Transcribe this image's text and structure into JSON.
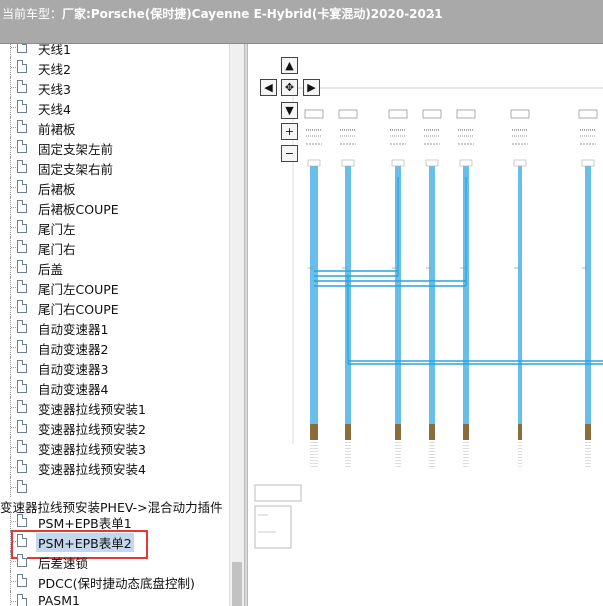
{
  "header": {
    "label": "当前车型：",
    "value": "厂家:Porsche(保时捷)Cayenne E-Hybrid(卡宴混动)2020-2021"
  },
  "tree": {
    "items": [
      {
        "label": "天线1"
      },
      {
        "label": "天线2"
      },
      {
        "label": "天线3"
      },
      {
        "label": "天线4"
      },
      {
        "label": "前裙板"
      },
      {
        "label": "固定支架左前"
      },
      {
        "label": "固定支架右前"
      },
      {
        "label": "后裙板"
      },
      {
        "label": "后裙板COUPE"
      },
      {
        "label": "尾门左"
      },
      {
        "label": "尾门右"
      },
      {
        "label": "后盖"
      },
      {
        "label": "尾门左COUPE"
      },
      {
        "label": "尾门右COUPE"
      },
      {
        "label": "自动变速器1"
      },
      {
        "label": "自动变速器2"
      },
      {
        "label": "自动变速器3"
      },
      {
        "label": "自动变速器4"
      },
      {
        "label": "变速器拉线预安装1"
      },
      {
        "label": "变速器拉线预安装2"
      },
      {
        "label": "变速器拉线预安装3"
      },
      {
        "label": "变速器拉线预安装4"
      },
      {
        "label": ""
      }
    ],
    "folder": "变速器拉线预安装PHEV->混合动力插件",
    "sub_items": [
      {
        "label": "PSM+EPB表单1"
      },
      {
        "label": "PSM+EPB表单2",
        "selected": true
      },
      {
        "label": "后差速锁"
      },
      {
        "label": "PDCC(保时捷动态底盘控制)"
      },
      {
        "label": "PASM1"
      }
    ]
  },
  "nav": {
    "up": "▲",
    "left": "◀",
    "center": "✥",
    "right": "▶",
    "down": "▼",
    "zoom_in": "+",
    "zoom_out": "−"
  },
  "colors": {
    "header_bg": "#a9a9a9",
    "wire": "#29a3e0",
    "selection_bg": "#c4d7ec",
    "highlight_box": "#e53935"
  }
}
